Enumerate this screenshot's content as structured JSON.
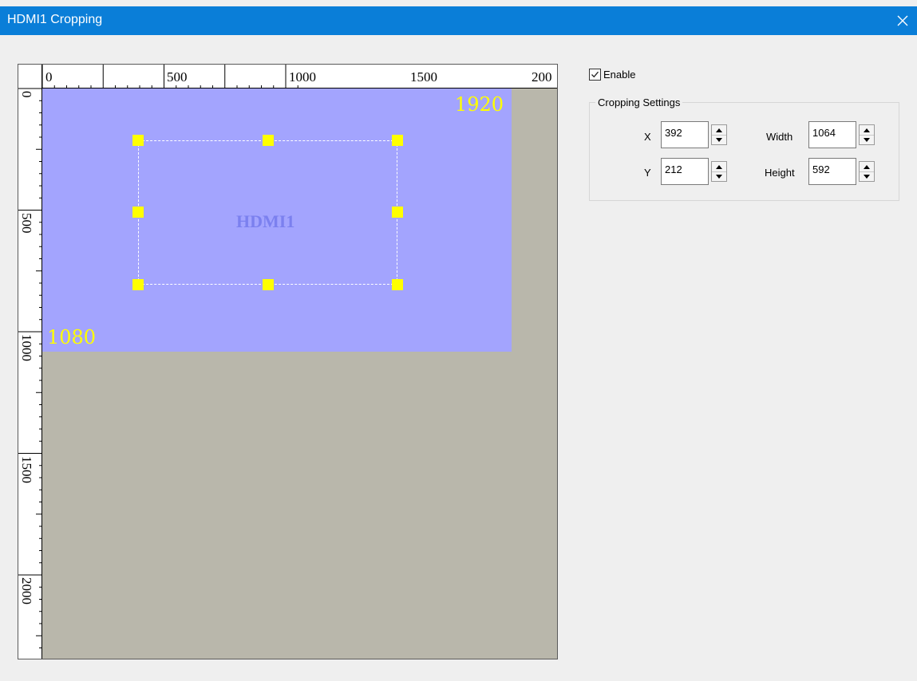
{
  "window": {
    "title": "HDMI1 Cropping"
  },
  "ruler": {
    "h_labels": [
      "0",
      "500",
      "1000",
      "1500",
      "200"
    ],
    "v_labels": [
      "0",
      "500",
      "1000",
      "1500",
      "2000"
    ]
  },
  "canvas": {
    "source_label": "HDMI1",
    "source_width": "1920",
    "source_height": "1080"
  },
  "enable": {
    "label": "Enable",
    "checked": true
  },
  "cropping": {
    "group_label": "Cropping Settings",
    "x_label": "X",
    "x_value": "392",
    "y_label": "Y",
    "y_value": "212",
    "width_label": "Width",
    "width_value": "1064",
    "height_label": "Height",
    "height_value": "592"
  },
  "colors": {
    "titlebar": "#0a7ed8",
    "source_area": "#a3a4fe",
    "canvas_bg": "#b9b7ab",
    "handles": "#ffff00"
  }
}
